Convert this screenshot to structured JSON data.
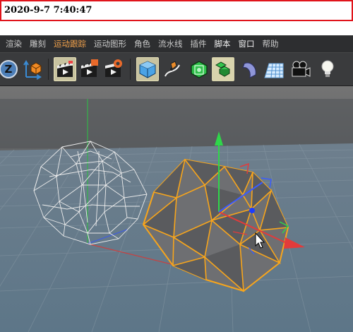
{
  "timestamp": "2020-9-7 7:40:47",
  "menu": {
    "items": [
      {
        "label": "渲染",
        "style": "normal"
      },
      {
        "label": "雕刻",
        "style": "normal"
      },
      {
        "label": "运动跟踪",
        "style": "hl"
      },
      {
        "label": "运动图形",
        "style": "normal"
      },
      {
        "label": "角色",
        "style": "normal"
      },
      {
        "label": "流水线",
        "style": "normal"
      },
      {
        "label": "插件",
        "style": "normal"
      },
      {
        "label": "脚本",
        "style": "bright"
      },
      {
        "label": "窗口",
        "style": "bright"
      },
      {
        "label": "帮助",
        "style": "normal"
      }
    ]
  },
  "toolbar": {
    "tools": [
      "undo-z-icon",
      "coordinate-axis-icon",
      "render-view-icon",
      "render-to-picture-viewer-icon",
      "render-settings-icon",
      "cube-icon",
      "pen-icon",
      "subdivision-icon",
      "array-icon",
      "deformer-icon",
      "floor-grid-icon",
      "camera-icon",
      "light-icon"
    ]
  },
  "colors": {
    "selection": "#f7a51c",
    "axis_x": "#e23b3b",
    "axis_y": "#2fd64a",
    "axis_z": "#3a5cff",
    "wireframe": "#e8e8e8"
  }
}
